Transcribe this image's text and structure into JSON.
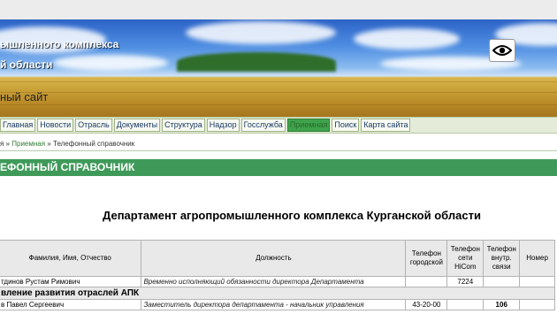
{
  "header": {
    "line1": "ышленного комплекса",
    "line2": "й области",
    "line3": "ный сайт",
    "eye_icon": "eye-icon"
  },
  "nav": {
    "items": [
      {
        "label": "Главная",
        "active": false
      },
      {
        "label": "Новости",
        "active": false
      },
      {
        "label": "Отрасль",
        "active": false
      },
      {
        "label": "Документы",
        "active": false
      },
      {
        "label": "Структура",
        "active": false
      },
      {
        "label": "Надзор",
        "active": false
      },
      {
        "label": "Госслужба",
        "active": false
      },
      {
        "label": "Приемная",
        "active": true
      },
      {
        "label": "Поиск",
        "active": false
      },
      {
        "label": "Карта сайта",
        "active": false
      }
    ]
  },
  "breadcrumb": {
    "prefix": "я »",
    "link": "Приемная",
    "sep": "»",
    "current": "Телефонный справочник"
  },
  "section": {
    "title": "ЕФОННЫЙ СПРАВОЧНИК"
  },
  "department": {
    "title": "Департамент агропромышленного комплекса Курганской области"
  },
  "table": {
    "headers": {
      "name": "Фамилия, Имя, Отчество",
      "position": "Должность",
      "phone_city": "Телефон городской",
      "phone_hicom": "Телефон сети HiCom",
      "phone_internal": "Телефон внутр. связи",
      "room": "Номер"
    },
    "rows": [
      {
        "name": "тдинов Рустам Римович",
        "position": "Временно исполняющий обязанности директора Департамента",
        "phone_city": "",
        "phone_hicom": "7224",
        "phone_internal": "",
        "room": ""
      }
    ],
    "group": "вление развития отраслей АПК",
    "rows2": [
      {
        "name": "в Павел Сергеевич",
        "position": "Заместитель директора департамента - начальник управления",
        "phone_city": "43-20-00",
        "phone_hicom": "",
        "phone_internal": "106",
        "room": ""
      }
    ]
  }
}
